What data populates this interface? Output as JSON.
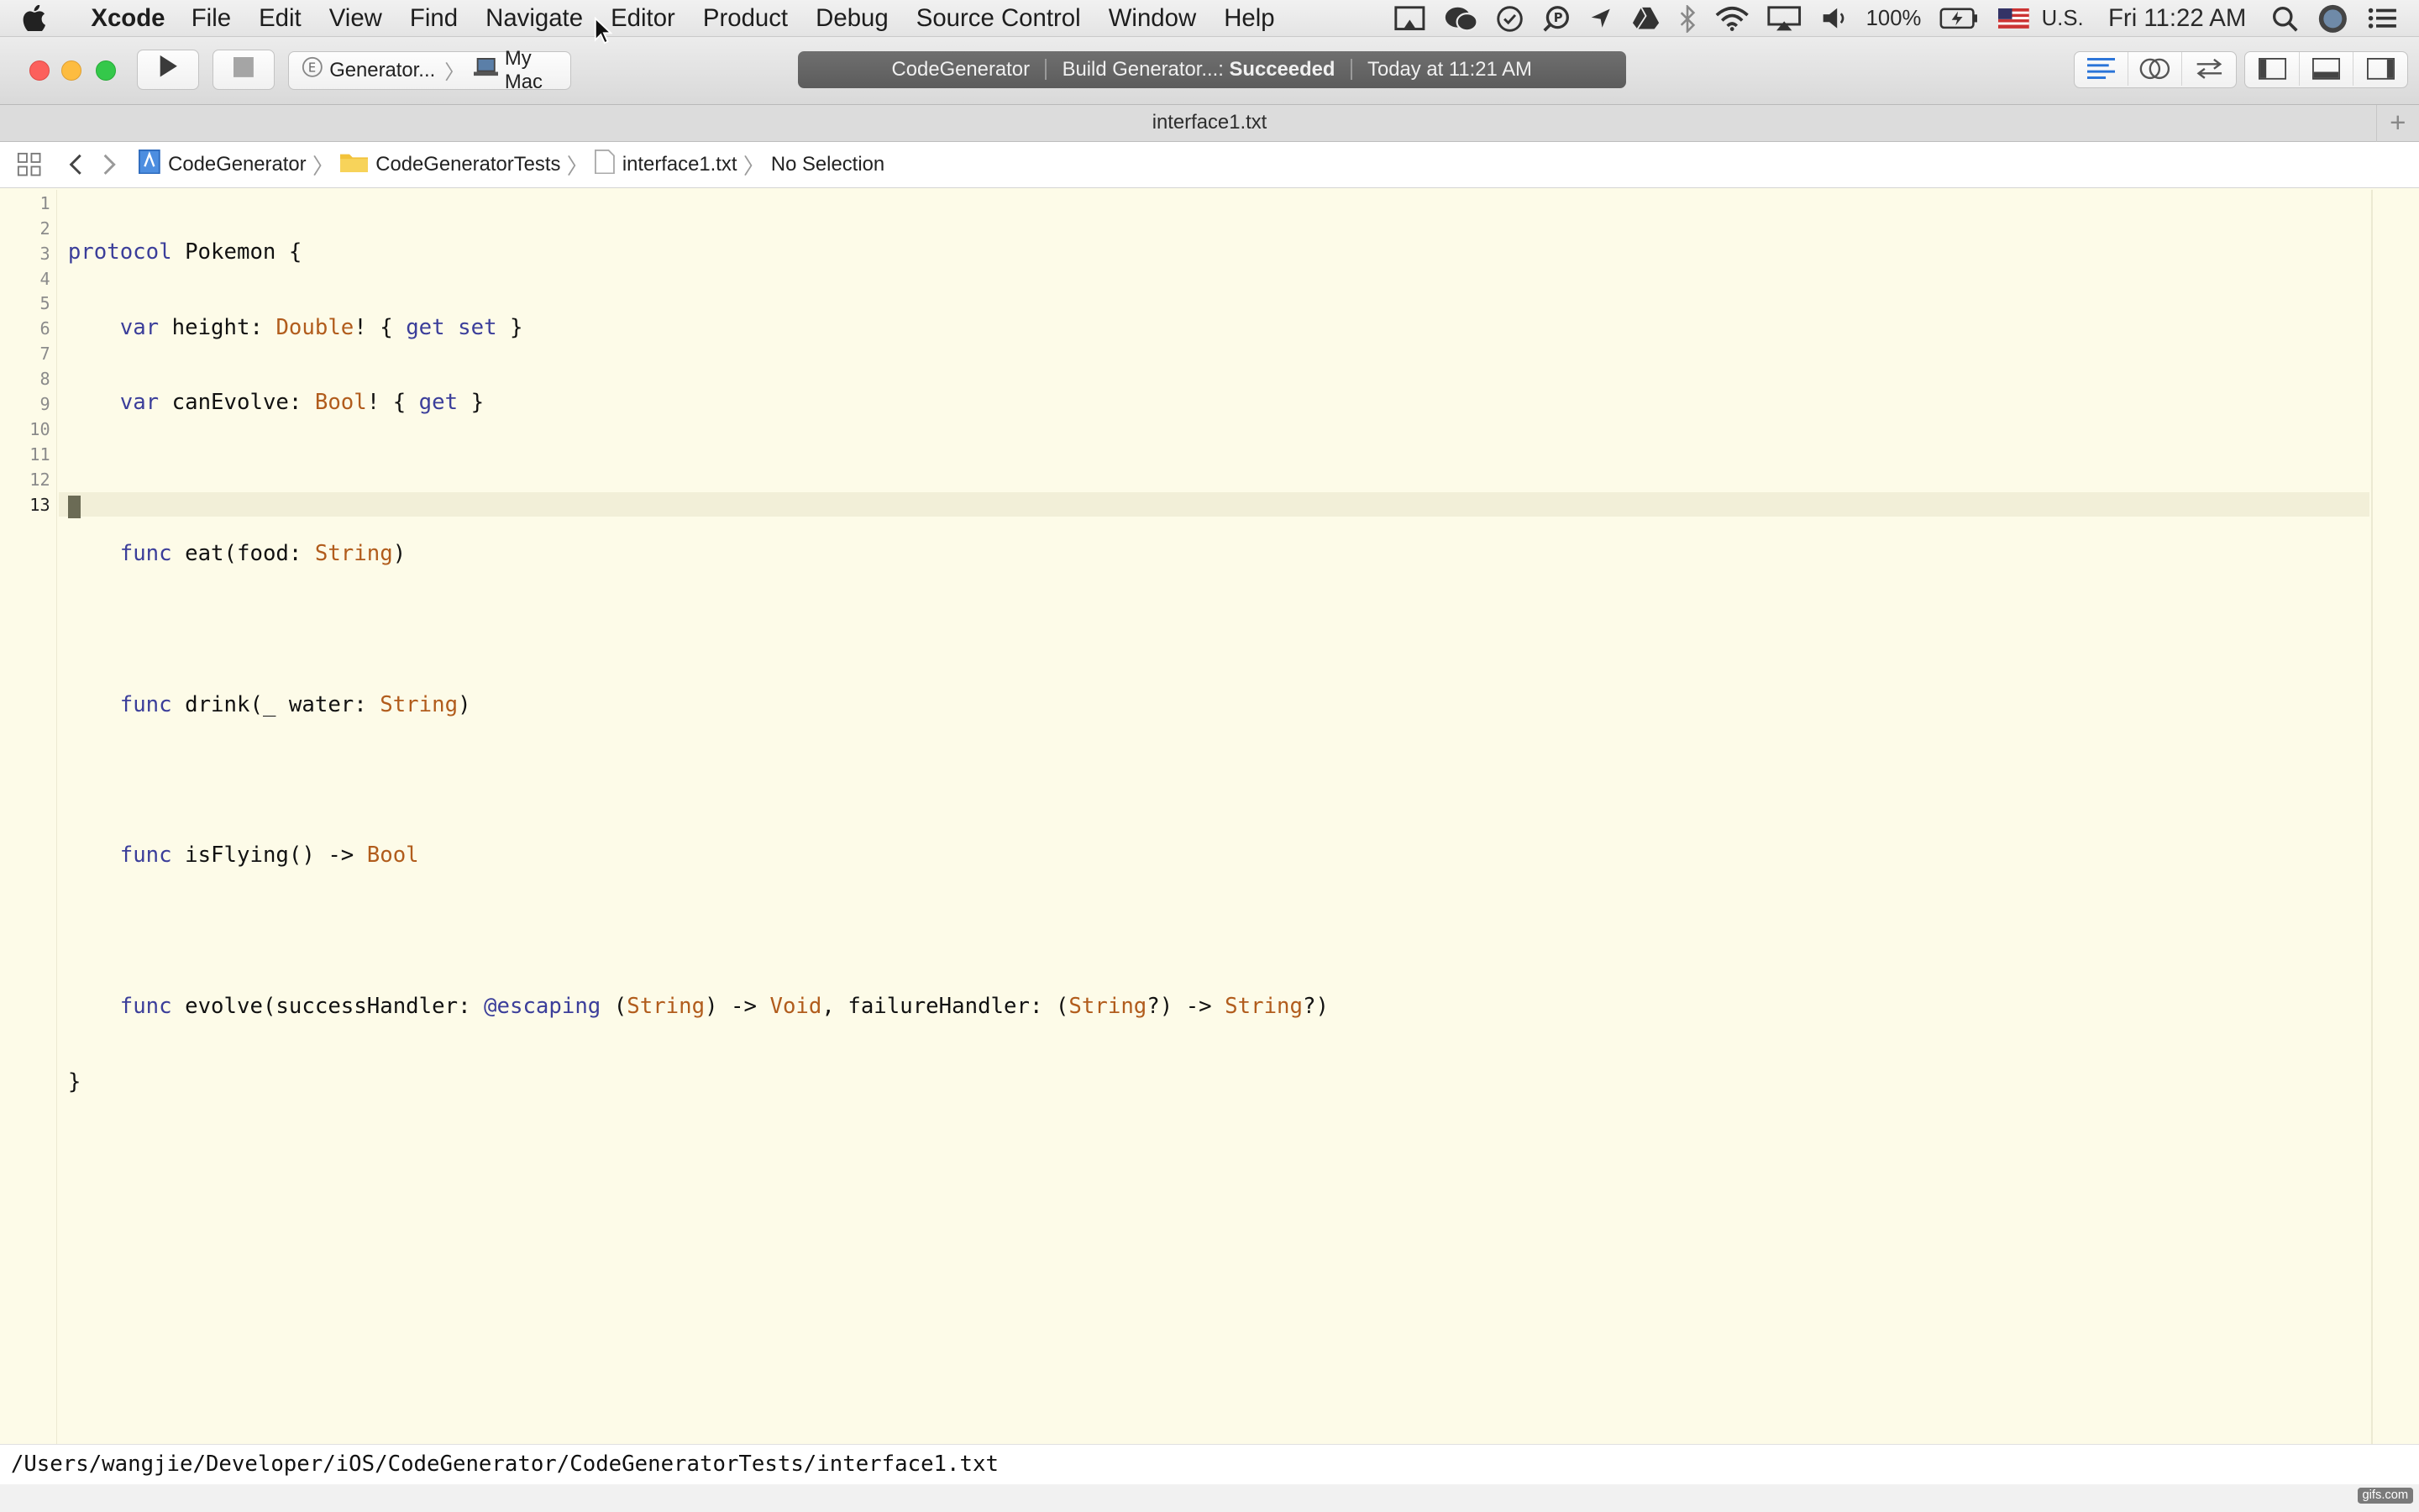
{
  "menubar": {
    "app": "Xcode",
    "items": [
      "File",
      "Edit",
      "View",
      "Find",
      "Navigate",
      "Editor",
      "Product",
      "Debug",
      "Source Control",
      "Window",
      "Help"
    ],
    "battery": "100%",
    "input_source": "U.S.",
    "clock": "Fri 11:22 AM"
  },
  "toolbar": {
    "scheme": "Generator...",
    "destination": "My Mac",
    "activity": {
      "project": "CodeGenerator",
      "task": "Build Generator...:",
      "result": "Succeeded",
      "time": "Today at 11:21 AM"
    }
  },
  "tab": {
    "title": "interface1.txt"
  },
  "jumpbar": {
    "project": "CodeGenerator",
    "folder": "CodeGeneratorTests",
    "file": "interface1.txt",
    "selection": "No Selection"
  },
  "editor": {
    "line_numbers": [
      "1",
      "2",
      "3",
      "4",
      "5",
      "6",
      "7",
      "8",
      "9",
      "10",
      "11",
      "12",
      "13"
    ],
    "current_line": 13
  },
  "pathbar": {
    "path": "/Users/wangjie/Developer/iOS/CodeGenerator/CodeGeneratorTests/interface1.txt"
  },
  "watermark": "gifs.com",
  "colors": {
    "editor_bg": "#fdfbe8",
    "keyword": "#3b3e9a",
    "type": "#b15c1c",
    "activity_bg": "#666666"
  }
}
